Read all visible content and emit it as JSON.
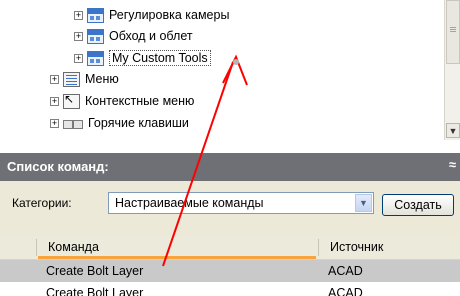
{
  "tree": {
    "items": [
      {
        "label": "Регулировка камеры",
        "icon": "toolbar-icon",
        "expander": "+"
      },
      {
        "label": "Обход и облет",
        "icon": "toolbar-icon",
        "expander": "+"
      },
      {
        "label": "My Custom Tools",
        "icon": "toolbar-icon",
        "expander": "+"
      },
      {
        "label": "Меню",
        "icon": "menu-icon",
        "expander": "+"
      },
      {
        "label": "Контекстные меню",
        "icon": "context-menu-icon",
        "expander": "+"
      },
      {
        "label": "Горячие клавиши",
        "icon": "shortcut-keys-icon",
        "expander": "+"
      }
    ]
  },
  "command_list": {
    "title": "Список команд:",
    "collapse_glyph": "≈",
    "categories_label": "Категории:",
    "categories_value": "Настраиваемые команды",
    "create_button": "Создать",
    "columns": {
      "command": "Команда",
      "source": "Источник"
    },
    "rows": [
      {
        "command": "Create Bolt Layer",
        "source": "ACAD"
      },
      {
        "command": "Create Bolt Layer",
        "source": "ACAD"
      }
    ]
  },
  "colors": {
    "section_bar": "#6f7076",
    "arrow": "#ff0000",
    "header_underline": "#f9a33d"
  }
}
